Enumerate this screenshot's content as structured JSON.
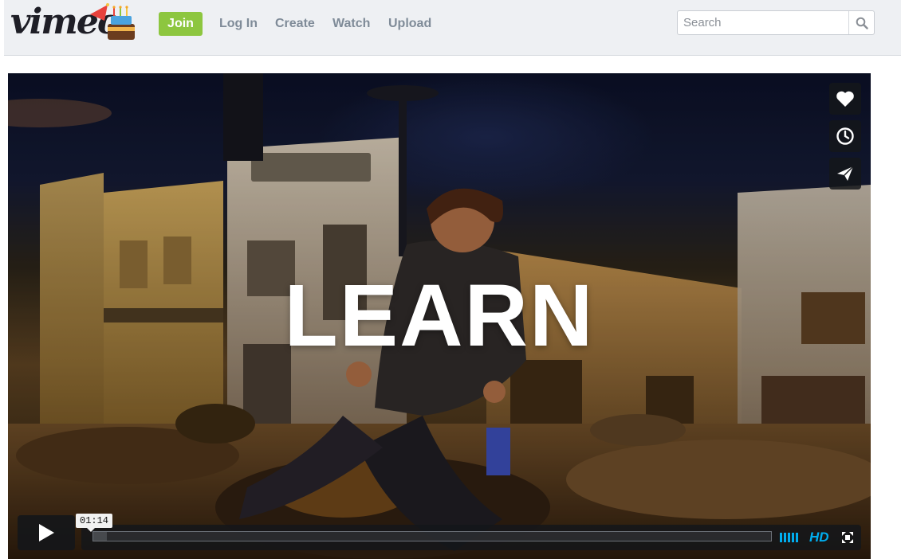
{
  "header": {
    "logo_text": "vimeo",
    "join_label": "Join",
    "nav": [
      "Log In",
      "Create",
      "Watch",
      "Upload"
    ],
    "search_placeholder": "Search"
  },
  "player": {
    "overlay_title": "LEARN",
    "current_time": "01:14",
    "quality_label": "HD",
    "progress_fraction": 0.02,
    "side_buttons": [
      "heart-icon",
      "clock-icon",
      "paper-plane-icon"
    ]
  },
  "colors": {
    "join_button": "#8dc63f",
    "nav_text": "#7f8b98",
    "hd_accent": "#00adef",
    "control_bg": "#14161a"
  }
}
